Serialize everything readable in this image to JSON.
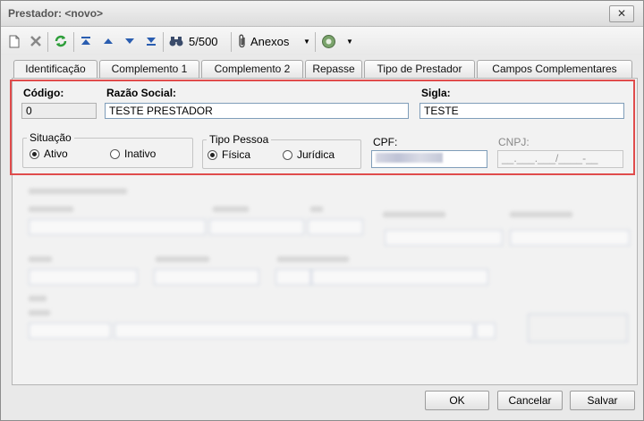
{
  "window": {
    "title": "Prestador: <novo>",
    "close_label": "✕"
  },
  "toolbar": {
    "record_counter": "5/500",
    "attachments_label": "Anexos",
    "dropdown_arrow": "▼"
  },
  "tabs": [
    {
      "label": "Identificação",
      "active": true
    },
    {
      "label": "Complemento 1",
      "active": false
    },
    {
      "label": "Complemento 2",
      "active": false
    },
    {
      "label": "Repasse",
      "active": false
    },
    {
      "label": "Tipo de Prestador",
      "active": false
    },
    {
      "label": "Campos Complementares",
      "active": false
    }
  ],
  "form": {
    "codigo": {
      "label": "Código:",
      "value": "0"
    },
    "razao_social": {
      "label": "Razão Social:",
      "value": "TESTE PRESTADOR"
    },
    "sigla": {
      "label": "Sigla:",
      "value": "TESTE"
    },
    "situacao": {
      "title": "Situação",
      "options": [
        {
          "label": "Ativo",
          "selected": true
        },
        {
          "label": "Inativo",
          "selected": false
        }
      ]
    },
    "tipo_pessoa": {
      "title": "Tipo Pessoa",
      "options": [
        {
          "label": "Física",
          "selected": true
        },
        {
          "label": "Jurídica",
          "selected": false
        }
      ]
    },
    "cpf": {
      "label": "CPF:",
      "value": ""
    },
    "cnpj": {
      "label": "CNPJ:",
      "value": "__.___.___/____-__"
    }
  },
  "buttons": {
    "ok": "OK",
    "cancel": "Cancelar",
    "save": "Salvar"
  },
  "colors": {
    "highlight": "#e04c4c",
    "field_border": "#7f9db9",
    "nav_blue": "#2a5db0",
    "refresh_green": "#2e9e3a"
  }
}
